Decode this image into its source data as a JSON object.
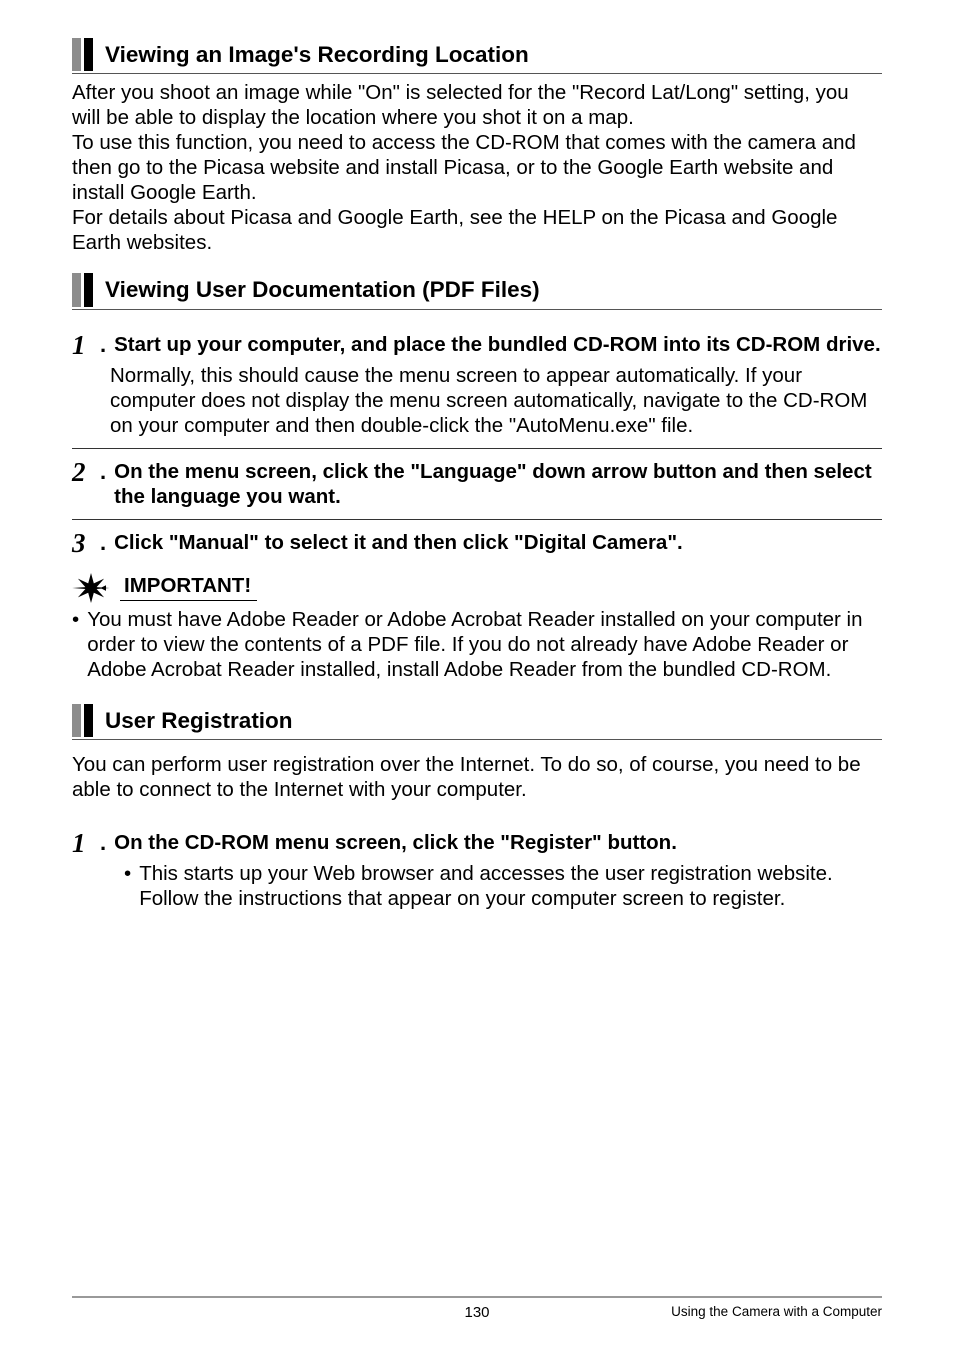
{
  "section1": {
    "heading": "Viewing an Image's Recording Location",
    "para": "After you shoot an image while \"On\" is selected for the \"Record Lat/Long\" setting, you will be able to display the location where you shot it on a map.\nTo use this function, you need to access the CD-ROM that comes with the camera and then go to the Picasa website and install Picasa, or to the Google Earth website and install Google Earth.\nFor details about Picasa and Google Earth, see the HELP on the Picasa and Google Earth websites."
  },
  "section2": {
    "heading": "Viewing User Documentation (PDF Files)",
    "step1": {
      "num": "1",
      "dot": ".",
      "text": "Start up your computer, and place the bundled CD-ROM into its CD-ROM drive.",
      "body": "Normally, this should cause the menu screen to appear automatically. If your computer does not display the menu screen automatically, navigate to the CD-ROM on your computer and then double-click the \"AutoMenu.exe\" file."
    },
    "step2": {
      "num": "2",
      "dot": ".",
      "text": "On the menu screen, click the \"Language\" down arrow button and then select the language you want."
    },
    "step3": {
      "num": "3",
      "dot": ".",
      "text": "Click \"Manual\" to select it and then click \"Digital Camera\"."
    },
    "important": {
      "label": "IMPORTANT!",
      "bullet_dot": "•",
      "bullet": "You must have Adobe Reader or Adobe Acrobat Reader installed on your computer in order to view the contents of a PDF file. If you do not already have Adobe Reader or Adobe Acrobat Reader installed, install Adobe Reader from the bundled CD-ROM."
    }
  },
  "section3": {
    "heading": "User Registration",
    "para": "You can perform user registration over the Internet. To do so, of course, you need to be able to connect to the Internet with your computer.",
    "step1": {
      "num": "1",
      "dot": ".",
      "text": "On the CD-ROM menu screen, click the \"Register\" button.",
      "sub_dot": "•",
      "sub": "This starts up your Web browser and accesses the user registration website. Follow the instructions that appear on your computer screen to register."
    }
  },
  "footer": {
    "page": "130",
    "chapter": "Using the Camera with a Computer"
  }
}
